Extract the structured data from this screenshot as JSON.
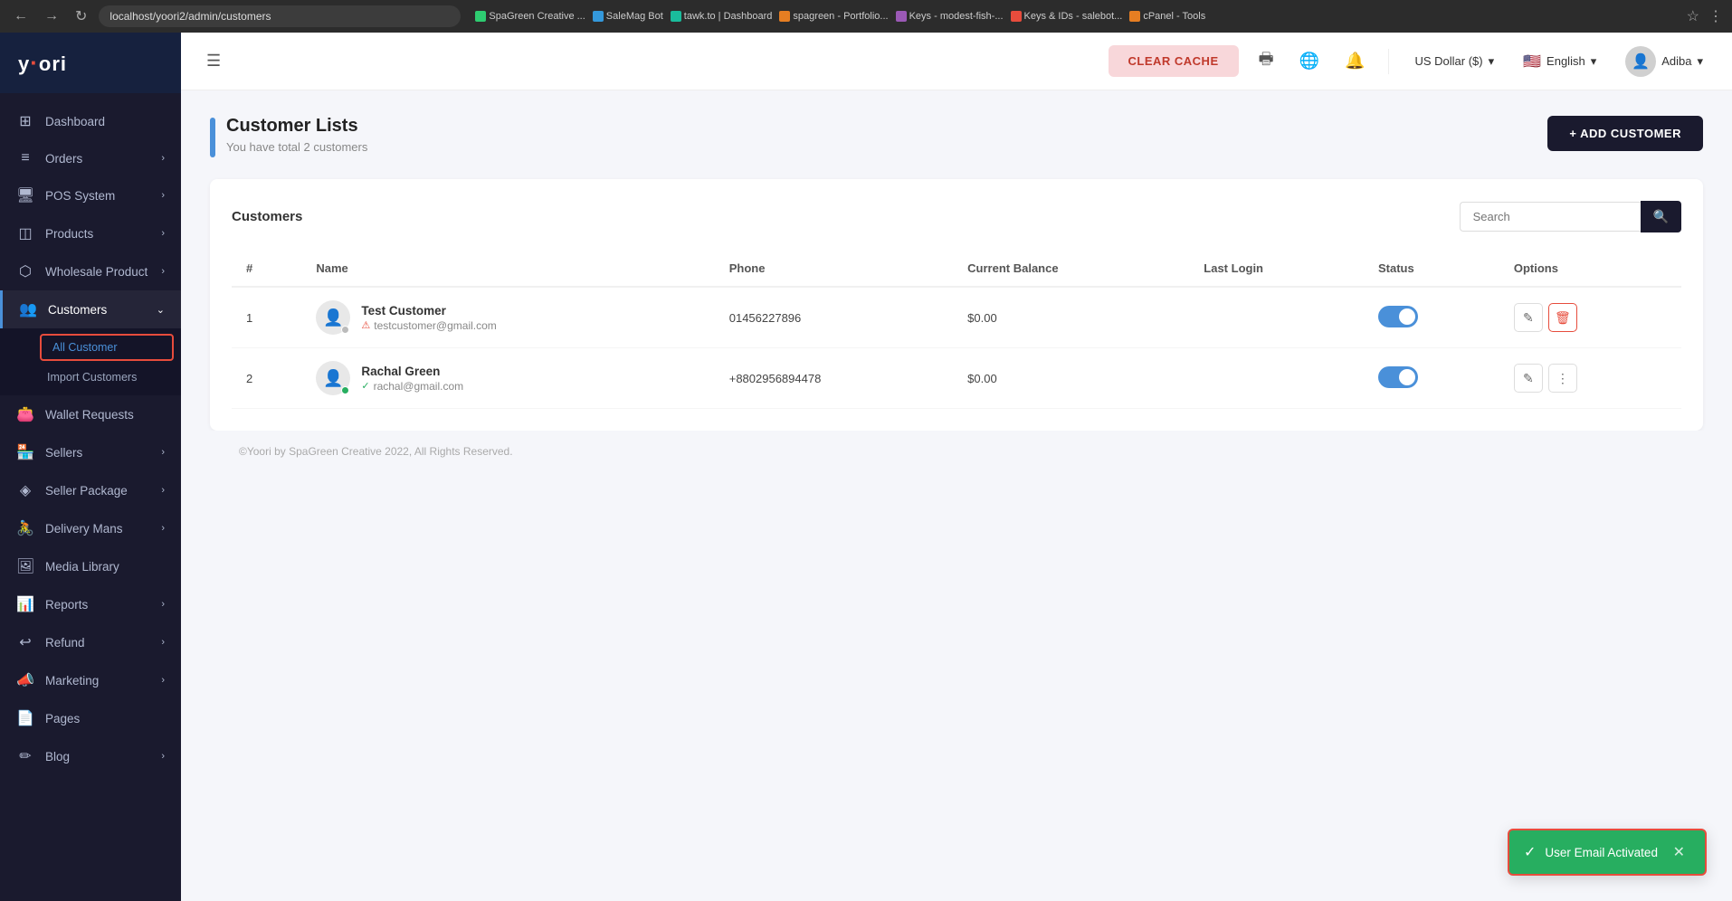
{
  "browser": {
    "url": "localhost/yoori2/admin/customers",
    "bookmarks": [
      {
        "label": "SpaGreen Creative ...",
        "color": "#2ecc71"
      },
      {
        "label": "SaleMag Bot",
        "color": "#3498db"
      },
      {
        "label": "tawk.to | Dashboard",
        "color": "#1abc9c"
      },
      {
        "label": "spagreen - Portfolio...",
        "color": "#e67e22"
      },
      {
        "label": "Keys - modest-fish-...",
        "color": "#9b59b6"
      },
      {
        "label": "Keys & IDs - salebot...",
        "color": "#e74c3c"
      },
      {
        "label": "cPanel - Tools",
        "color": "#e67e22"
      }
    ]
  },
  "sidebar": {
    "logo": "yoori",
    "logo_dot": "·",
    "nav_items": [
      {
        "id": "dashboard",
        "label": "Dashboard",
        "icon": "⊞"
      },
      {
        "id": "orders",
        "label": "Orders",
        "icon": "📋",
        "has_chevron": true
      },
      {
        "id": "pos",
        "label": "POS System",
        "icon": "🖥",
        "has_chevron": true
      },
      {
        "id": "products",
        "label": "Products",
        "icon": "📦",
        "has_chevron": true
      },
      {
        "id": "wholesale",
        "label": "Wholesale Product",
        "icon": "🏭",
        "has_chevron": true
      },
      {
        "id": "customers",
        "label": "Customers",
        "icon": "👥",
        "has_chevron": true,
        "active": true
      },
      {
        "id": "wallet",
        "label": "Wallet Requests",
        "icon": "👛"
      },
      {
        "id": "sellers",
        "label": "Sellers",
        "icon": "🏪",
        "has_chevron": true
      },
      {
        "id": "seller_package",
        "label": "Seller Package",
        "icon": "📦",
        "has_chevron": true
      },
      {
        "id": "delivery",
        "label": "Delivery Mans",
        "icon": "🚴",
        "has_chevron": true
      },
      {
        "id": "media",
        "label": "Media Library",
        "icon": "🖼"
      },
      {
        "id": "reports",
        "label": "Reports",
        "icon": "📊",
        "has_chevron": true
      },
      {
        "id": "refund",
        "label": "Refund",
        "icon": "↩",
        "has_chevron": true
      },
      {
        "id": "marketing",
        "label": "Marketing",
        "icon": "📣",
        "has_chevron": true
      },
      {
        "id": "pages",
        "label": "Pages",
        "icon": "📄"
      },
      {
        "id": "blog",
        "label": "Blog",
        "icon": "✏",
        "has_chevron": true
      }
    ],
    "sub_items": [
      {
        "id": "all_customer",
        "label": "All Customer",
        "active": true
      },
      {
        "id": "import_customers",
        "label": "Import Customers"
      }
    ]
  },
  "header": {
    "clear_cache_label": "CLEAR CACHE",
    "currency": "US Dollar ($)",
    "language": "English",
    "user": "Adiba"
  },
  "page": {
    "title": "Customer Lists",
    "subtitle": "You have total 2 customers",
    "add_button": "+ ADD CUSTOMER",
    "table_title": "Customers",
    "search_placeholder": "Search",
    "columns": [
      "#",
      "Name",
      "Phone",
      "Current Balance",
      "Last Login",
      "Status",
      "Options"
    ],
    "customers": [
      {
        "num": 1,
        "name": "Test Customer",
        "email": "testcustomer@gmail.com",
        "email_verified": false,
        "phone": "01456227896",
        "balance": "$0.00",
        "last_login": "",
        "status": true,
        "online": false
      },
      {
        "num": 2,
        "name": "Rachal Green",
        "email": "rachal@gmail.com",
        "email_verified": true,
        "phone": "+8802956894478",
        "balance": "$0.00",
        "last_login": "",
        "status": true,
        "online": true
      }
    ]
  },
  "footer": {
    "text": "©Yoori by SpaGreen Creative 2022, All Rights Reserved."
  },
  "toast": {
    "message": "User Email Activated",
    "icon": "✓"
  }
}
